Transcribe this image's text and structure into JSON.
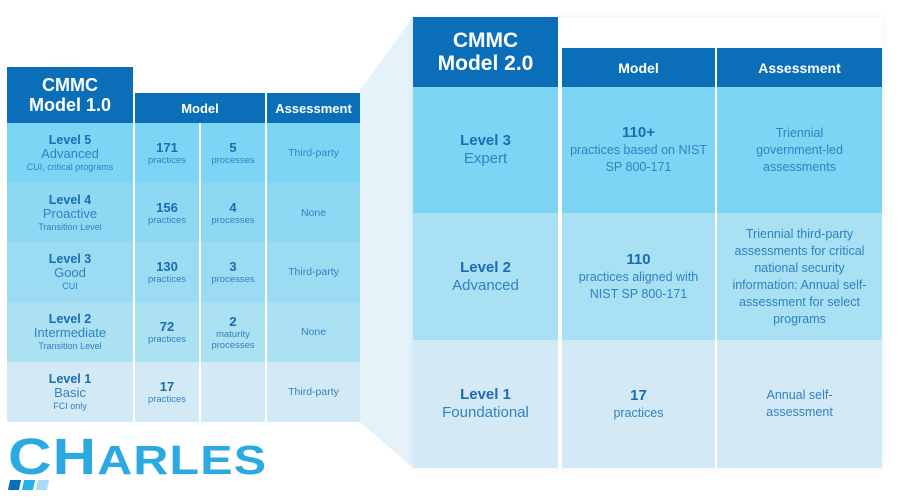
{
  "colors": {
    "header_blue": "#0a6fb8",
    "logo_blue": "#2aa9e2",
    "logo_squares": [
      "#0a6fb8",
      "#29b0ea",
      "#a8dcf5"
    ],
    "connector": "#e6f2fa",
    "model_1_rows": [
      "#7dd5f5",
      "#8ed8f3",
      "#9cdcf3",
      "#abe1f3",
      "#d3eaf6"
    ],
    "model_2_rows": [
      "#7dd5f5",
      "#a9e0f3",
      "#d3eaf6"
    ]
  },
  "model_1": {
    "title_line1": "CMMC",
    "title_line2": "Model 1.0",
    "headers": {
      "model": "Model",
      "assessment": "Assessment"
    },
    "rows": [
      {
        "level": "Level 5",
        "name": "Advanced",
        "note": "CUI, critical programs",
        "practices": "171",
        "practices_label": "practices",
        "processes": "5",
        "processes_label": "processes",
        "assessment": "Third-party"
      },
      {
        "level": "Level 4",
        "name": "Proactive",
        "note": "Transition Level",
        "practices": "156",
        "practices_label": "practices",
        "processes": "4",
        "processes_label": "processes",
        "assessment": "None"
      },
      {
        "level": "Level 3",
        "name": "Good",
        "note": "CUI",
        "practices": "130",
        "practices_label": "practices",
        "processes": "3",
        "processes_label": "processes",
        "assessment": "Third-party"
      },
      {
        "level": "Level 2",
        "name": "Intermediate",
        "note": "Transition Level",
        "practices": "72",
        "practices_label": "practices",
        "processes": "2",
        "processes_label": "maturity processes",
        "assessment": "None"
      },
      {
        "level": "Level 1",
        "name": "Basic",
        "note": "FCI only",
        "practices": "17",
        "practices_label": "practices",
        "processes": "",
        "processes_label": "",
        "assessment": "Third-party"
      }
    ]
  },
  "model_2": {
    "title_line1": "CMMC",
    "title_line2": "Model 2.0",
    "headers": {
      "model": "Model",
      "assessment": "Assessment"
    },
    "rows": [
      {
        "level": "Level 3",
        "name": "Expert",
        "practices": "110+",
        "practices_desc": "practices based on NIST SP 800-171",
        "assessment": "Triennial government-led assessments"
      },
      {
        "level": "Level 2",
        "name": "Advanced",
        "practices": "110",
        "practices_desc": "practices aligned with NIST SP 800-171",
        "assessment": "Triennial third-party assessments for critical national security information: Annual self-assessment for select programs"
      },
      {
        "level": "Level 1",
        "name": "Foundational",
        "practices": "17",
        "practices_desc": "practices",
        "assessment": "Annual self-assessment"
      }
    ]
  },
  "logo": {
    "lead": "CH",
    "rest": "ARLES"
  }
}
